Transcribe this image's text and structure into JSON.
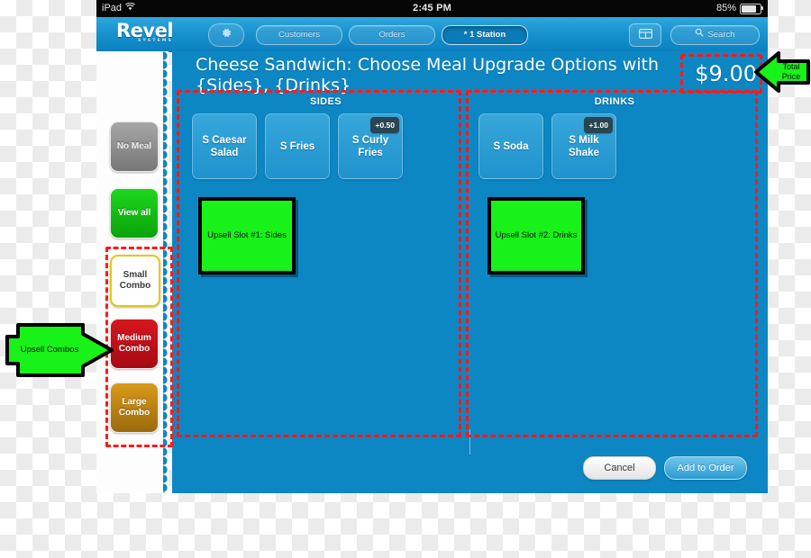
{
  "status_bar": {
    "device": "iPad",
    "wifi_icon": "wifi-icon",
    "time": "2:45 PM",
    "battery_percent": "85%"
  },
  "nav": {
    "brand": "Revel",
    "brand_sub": "SYSTEMS",
    "gear_icon": "gear-icon",
    "grid_icon": "grid-icon",
    "search_icon": "search-icon",
    "items": [
      {
        "label": "Customers",
        "active": false
      },
      {
        "label": "Orders",
        "active": false
      },
      {
        "label": "* 1 Station",
        "active": true
      }
    ],
    "search_label": "Search"
  },
  "sidebar": {
    "items": [
      {
        "label": "No Meal",
        "name": "sidebar-item-no-meal"
      },
      {
        "label": "View all",
        "name": "sidebar-item-view-all"
      },
      {
        "label": "Small Combo",
        "name": "sidebar-item-small-combo"
      },
      {
        "label": "Medium Combo",
        "name": "sidebar-item-medium-combo"
      },
      {
        "label": "Large Combo",
        "name": "sidebar-item-large-combo"
      }
    ]
  },
  "header": {
    "title": "Cheese Sandwich: Choose Meal Upgrade Options with {Sides}, {Drinks}",
    "price": "$9.00"
  },
  "sides": {
    "header": "SIDES",
    "items": [
      {
        "label": "S Caesar Salad",
        "surcharge": ""
      },
      {
        "label": "S Fries",
        "surcharge": ""
      },
      {
        "label": "S Curly Fries",
        "surcharge": "+0.50"
      }
    ]
  },
  "drinks": {
    "header": "DRINKS",
    "items": [
      {
        "label": "S Soda",
        "surcharge": ""
      },
      {
        "label": "S Milk Shake",
        "surcharge": "+1.00"
      }
    ]
  },
  "footer": {
    "cancel_label": "Cancel",
    "add_label": "Add to Order"
  },
  "annotations": {
    "upsell_slot_1": "Upsell Slot #1: Sides",
    "upsell_slot_2": "Upsell Slot #2: Drinks",
    "upsell_combos_arrow": "Upsell Combos",
    "total_price_arrow": "Total Price"
  },
  "colors": {
    "app_blue": "#0d86c4",
    "tile_blue": "#2d9dd4",
    "annotation_red": "#ff1a1a",
    "annotation_green": "#18f218",
    "nav_blue": "#1893cf"
  }
}
